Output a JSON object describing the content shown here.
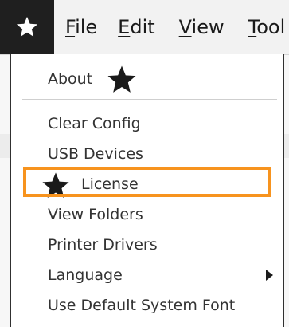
{
  "menubar": {
    "logo_icon": "star-icon",
    "menus": {
      "file": {
        "accel": "F",
        "rest": "ile"
      },
      "edit": {
        "accel": "E",
        "rest": "dit"
      },
      "view": {
        "accel": "V",
        "rest": "iew"
      },
      "tool": {
        "accel": "T",
        "rest": "ool"
      }
    }
  },
  "dropdown": {
    "items": {
      "about": "About",
      "clear_config": "Clear Config",
      "usb_devices": "USB Devices",
      "license": "License",
      "view_folders": "View Folders",
      "printer_drivers": "Printer Drivers",
      "language": "Language",
      "default_font": "Use Default System Font"
    },
    "annotation_icon": "star-icon"
  },
  "colors": {
    "highlight": "#f7931e",
    "logo_bg": "#1f1f1f",
    "menubar_bg": "#f2f2f2"
  }
}
